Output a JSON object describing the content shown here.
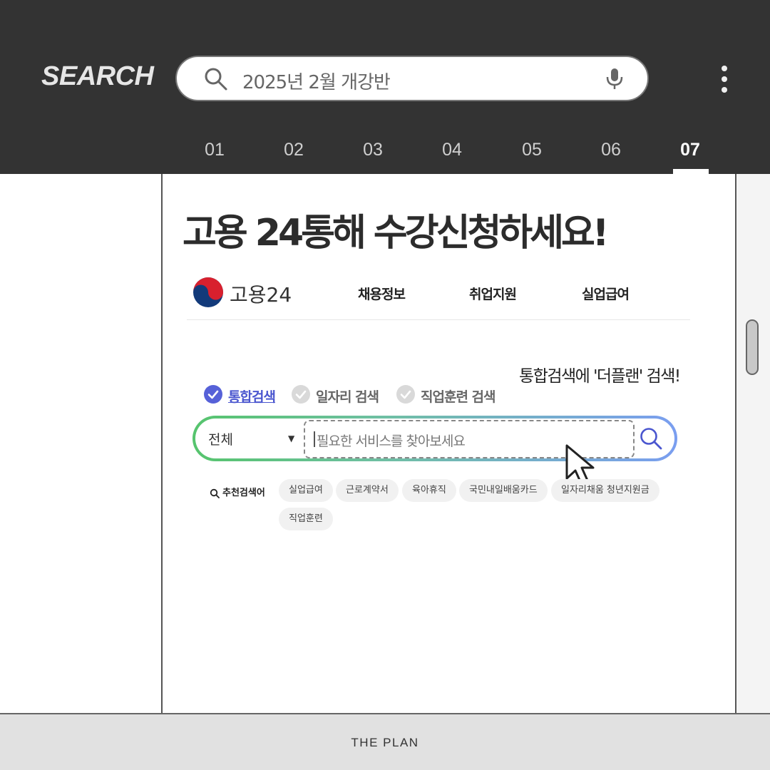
{
  "header": {
    "brand": "SEARCH",
    "search_query": "2025년 2월 개강반",
    "tabs": [
      "01",
      "02",
      "03",
      "04",
      "05",
      "06",
      "07"
    ],
    "active_tab": "07",
    "colors": {
      "background": "#333333",
      "tab_active": "#ffffff"
    }
  },
  "content": {
    "headline": "고용 24통해 수강신청하세요!",
    "site": {
      "logo_icon": "taegeuk-logo-icon",
      "name": "고용24",
      "nav": [
        "채용정보",
        "취업지원",
        "실업급여"
      ]
    },
    "callout": "통합검색에 '더플랜' 검색!",
    "search_options": [
      {
        "label": "통합검색",
        "checked": true
      },
      {
        "label": "일자리 검색",
        "checked": false
      },
      {
        "label": "직업훈련 검색",
        "checked": false
      }
    ],
    "search_box": {
      "category": "전체",
      "placeholder": "필요한 서비스를 찾아보세요"
    },
    "recommended": {
      "label": "추천검색어",
      "chips": [
        "실업급여",
        "근로계약서",
        "육아휴직",
        "국민내일배움카드",
        "일자리채움 청년지원금",
        "직업훈련"
      ]
    },
    "colors": {
      "accent": "#5661d8",
      "gradient_start": "#56c46d",
      "gradient_end": "#7a9ef0"
    }
  },
  "footer": {
    "text": "THE PLAN"
  }
}
